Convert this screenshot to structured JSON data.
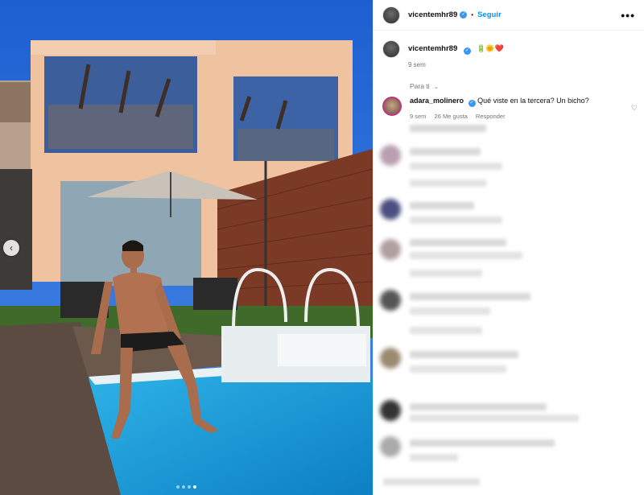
{
  "post": {
    "username": "vicentemhr89",
    "follow_label": "Seguir",
    "caption_emojis": "🔋🌞❤️",
    "caption_time": "9 sem",
    "more_label": "•••"
  },
  "comments_section": {
    "filter_label": "Para ti",
    "comments": [
      {
        "username": "adara_molinero",
        "text": "Qué viste en la tercera? Un bicho?",
        "time": "9 sem",
        "likes": "26 Me gusta",
        "reply_label": "Responder"
      }
    ]
  },
  "carousel": {
    "total_slides": 4,
    "active_slide": 4
  },
  "colors": {
    "follow_blue": "#0095f6",
    "verified_blue": "#3897f0",
    "muted": "#737373"
  },
  "icons": [
    "chevron-left-icon",
    "more-icon",
    "verified-icon",
    "heart-icon",
    "chevron-down-icon"
  ]
}
